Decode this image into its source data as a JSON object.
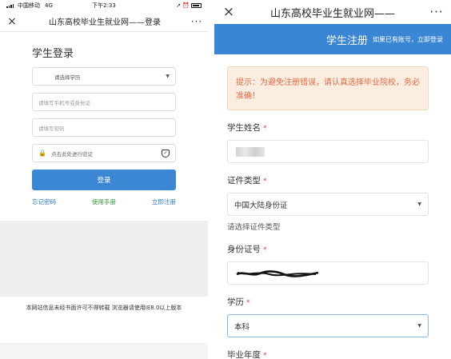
{
  "left": {
    "status": {
      "carrier": "中国移动",
      "network": "4G",
      "time": "下午2:33"
    },
    "nav": {
      "close": "×",
      "title": "山东高校毕业生就业网——登录",
      "more": "···"
    },
    "login": {
      "title": "学生登录",
      "education_select": "请选择学历",
      "phone_placeholder": "请填写手机号或身份证",
      "password_placeholder": "请填写密码",
      "verify_text": "点击此处进行验证",
      "button": "登录",
      "links": {
        "forgot": "忘记密码",
        "manual": "使用手册",
        "register": "立即注册"
      }
    },
    "footer": "本网站信息未经书面许可不得转载 浏览器请使用IE8.0以上版本"
  },
  "right": {
    "nav": {
      "close": "×",
      "title": "山东高校毕业生就业网——",
      "more": "···"
    },
    "header": {
      "title": "学生注册",
      "subtitle": "如果已有账号，",
      "login_link": "立即登录"
    },
    "tip": "提示：为避免注册错误，请认真选择毕业院校，务必准确！",
    "fields": {
      "name_label": "学生姓名",
      "cert_label": "证件类型",
      "cert_value": "中国大陆身份证",
      "cert_hint": "请选择证件类型",
      "id_label": "身份证号",
      "edu_label": "学历",
      "edu_value": "本科",
      "year_label": "毕业年度",
      "required": "*"
    }
  },
  "colors": {
    "primary": "#3b86d4",
    "tip_text": "#e06a44",
    "tip_bg": "#fbeee0",
    "link_green": "#2e9b3a",
    "required_red": "#e0463a"
  }
}
